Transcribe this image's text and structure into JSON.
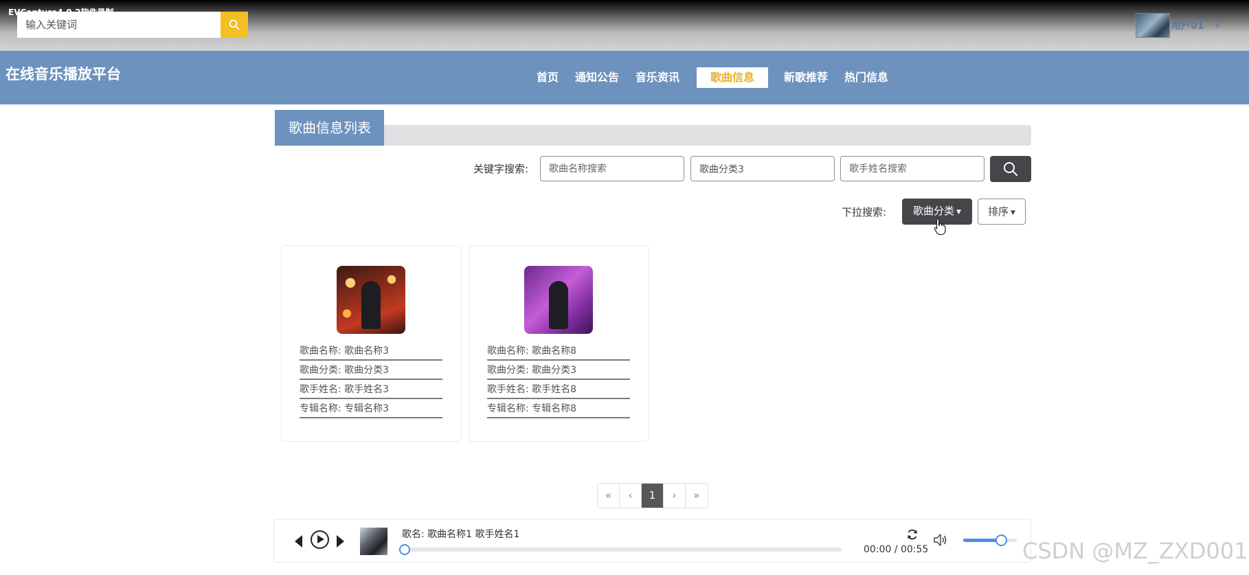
{
  "watermark_top": "EVCapture4.0.2软件录制",
  "header": {
    "search_placeholder": "输入关键词",
    "user_name": "用户01"
  },
  "brand": "在线音乐播放平台",
  "nav": {
    "items": [
      {
        "label": "首页",
        "active": false
      },
      {
        "label": "通知公告",
        "active": false
      },
      {
        "label": "音乐资讯",
        "active": false
      },
      {
        "label": "歌曲信息",
        "active": true
      },
      {
        "label": "新歌推荐",
        "active": false
      },
      {
        "label": "热门信息",
        "active": false
      }
    ]
  },
  "list_title": "歌曲信息列表",
  "search": {
    "label": "关键字搜索:",
    "name_placeholder": "歌曲名称搜索",
    "category_value": "歌曲分类3",
    "singer_placeholder": "歌手姓名搜索"
  },
  "dropdown": {
    "label": "下拉搜索:",
    "category_button": "歌曲分类",
    "sort_button": "排序"
  },
  "cards": [
    {
      "name": "歌曲名称: 歌曲名称3",
      "category": "歌曲分类: 歌曲分类3",
      "singer": "歌手姓名: 歌手姓名3",
      "album": "专辑名称: 专辑名称3"
    },
    {
      "name": "歌曲名称: 歌曲名称8",
      "category": "歌曲分类: 歌曲分类3",
      "singer": "歌手姓名: 歌手姓名8",
      "album": "专辑名称: 专辑名称8"
    }
  ],
  "pagination": {
    "first": "«",
    "prev": "‹",
    "current": "1",
    "next": "›",
    "last": "»"
  },
  "player": {
    "song_line": "歌名: 歌曲名称1 歌手姓名1",
    "time": "00:00 / 00:55",
    "progress": 0,
    "volume": 0.7
  },
  "colors": {
    "nav_bg": "#6d92bd",
    "accent_yellow": "#f2bf24",
    "dark_button": "#444649",
    "player_blue": "#4a90e2"
  },
  "watermark_bottom": "CSDN @MZ_ZXD001"
}
